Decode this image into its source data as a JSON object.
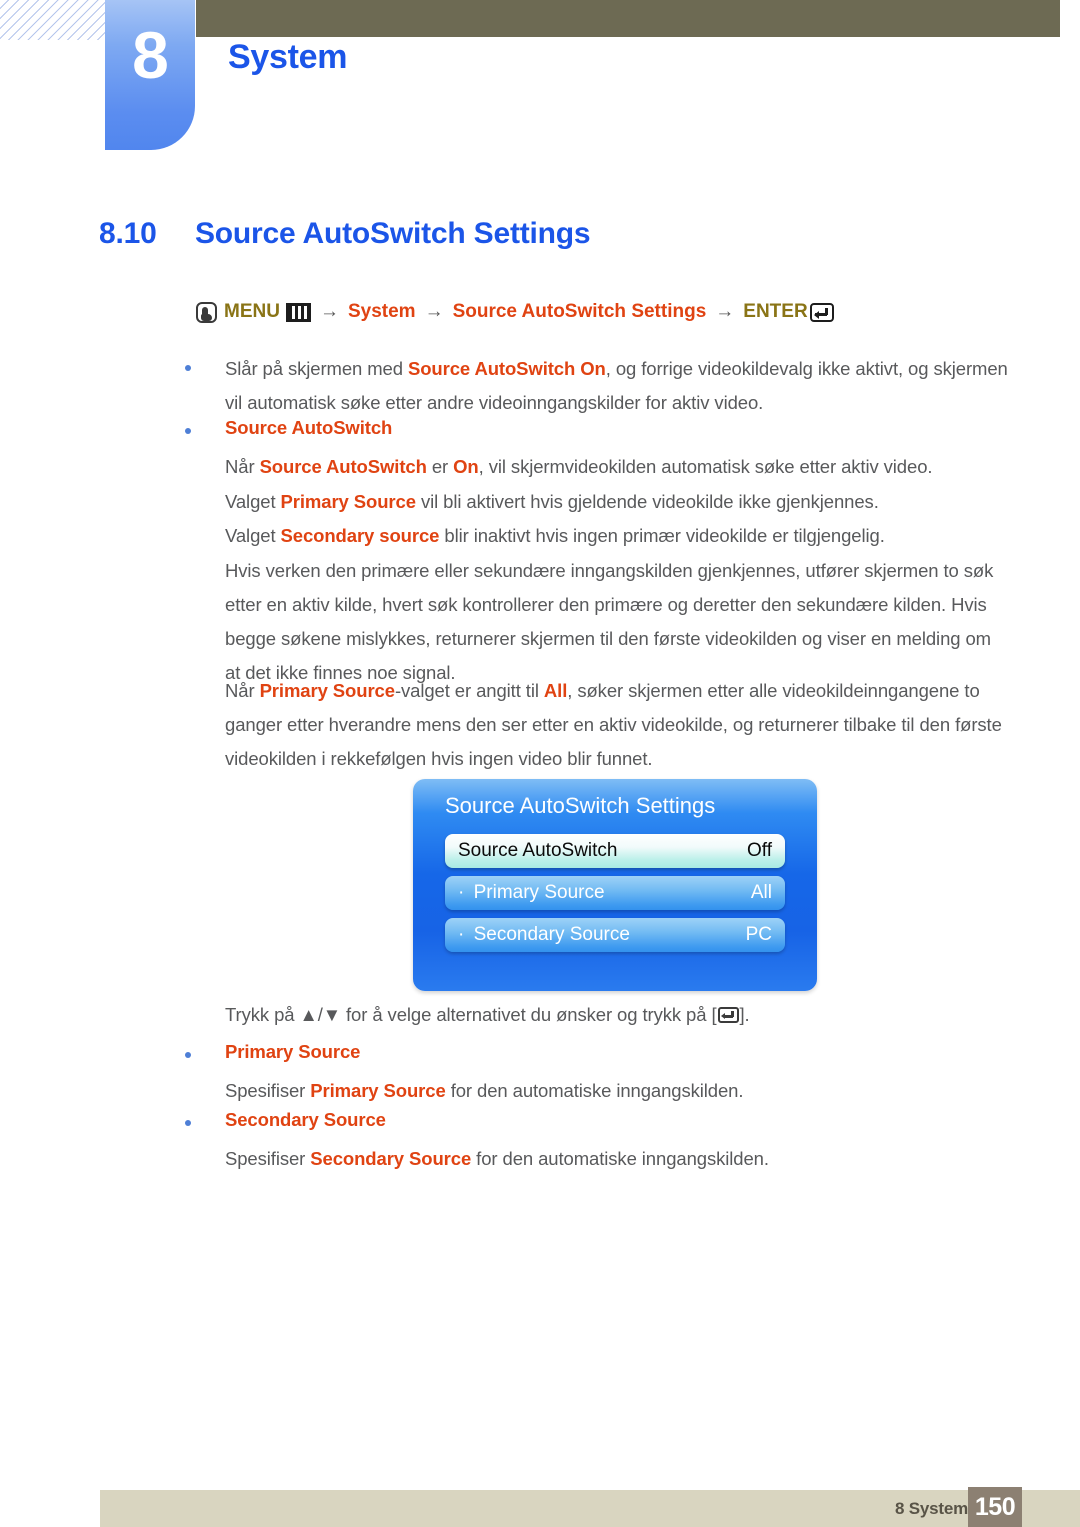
{
  "chapter": {
    "number": "8",
    "title": "System"
  },
  "section": {
    "number": "8.10",
    "title": "Source AutoSwitch Settings"
  },
  "breadcrumb": {
    "menu_label": "MENU",
    "arrow": "→",
    "item1": "System",
    "item2": "Source AutoSwitch Settings",
    "enter_label": "ENTER",
    "olive_color": "#8a7416",
    "orange_color": "#e04312"
  },
  "content": {
    "b1_pre": "Slår på skjermen med ",
    "b1_hl": "Source AutoSwitch On",
    "b1_post": ", og forrige videokildevalg ikke aktivt, og skjermen vil automatisk søke etter andre videoinngangskilder for aktiv video.",
    "b2_head": "Source AutoSwitch",
    "p1_a": "Når ",
    "p1_hl1": "Source AutoSwitch",
    "p1_b": " er ",
    "p1_hl2": "On",
    "p1_c": ", vil skjermvideokilden automatisk søke etter aktiv video.",
    "p2_a": "Valget ",
    "p2_hl": "Primary Source",
    "p2_b": " vil bli aktivert hvis gjeldende videokilde ikke gjenkjennes.",
    "p3_a": "Valget ",
    "p3_hl": "Secondary source",
    "p3_b": " blir inaktivt hvis ingen primær videokilde er tilgjengelig.",
    "p4": "Hvis verken den primære eller sekundære inngangskilden gjenkjennes, utfører skjermen to søk etter en aktiv kilde, hvert søk kontrollerer den primære og deretter den sekundære kilden. Hvis begge søkene mislykkes, returnerer skjermen til den første videokilden og viser en melding om at det ikke finnes noe signal.",
    "p5_a": "Når ",
    "p5_hl1": "Primary Source",
    "p5_b": "-valget er angitt til ",
    "p5_hl2": "All",
    "p5_c": ", søker skjermen etter alle videokildeinngangene to ganger etter hverandre mens den ser etter en aktiv videokilde, og returnerer tilbake til den første videokilden i rekkefølgen hvis ingen video blir funnet.",
    "instr_a": "Trykk på ",
    "instr_arrows": "▲/▼",
    "instr_b": " for å velge alternativet du ønsker og trykk på [",
    "instr_c": "].",
    "b3_head": "Primary Source",
    "p6_a": "Spesifiser ",
    "p6_hl": "Primary Source",
    "p6_b": " for den automatiske inngangskilden.",
    "b4_head": "Secondary Source",
    "p7_a": "Spesifiser ",
    "p7_hl": "Secondary Source",
    "p7_b": " for den automatiske inngangskilden."
  },
  "osd": {
    "title": "Source AutoSwitch Settings",
    "rows": [
      {
        "label": "Source AutoSwitch",
        "value": "Off",
        "prefix": "",
        "selected": true
      },
      {
        "label": "Primary Source",
        "value": "All",
        "prefix": "· ",
        "selected": false
      },
      {
        "label": "Secondary Source",
        "value": "PC",
        "prefix": "· ",
        "selected": false
      }
    ]
  },
  "footer": {
    "label": "8 System",
    "page": "150"
  }
}
